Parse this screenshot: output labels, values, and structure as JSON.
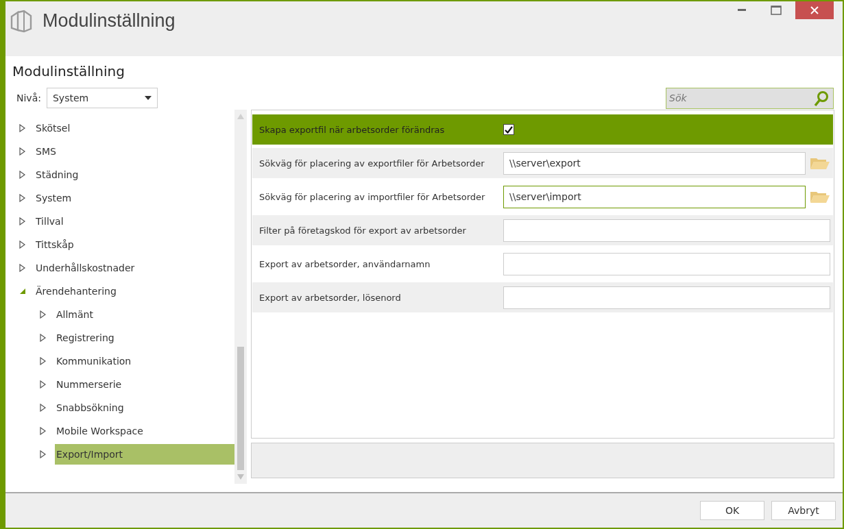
{
  "window": {
    "title": "Modulinställning"
  },
  "heading": "Modulinställning",
  "level_picker": {
    "label": "Nivå:",
    "value": "System"
  },
  "search": {
    "placeholder": "Sök"
  },
  "tree": [
    {
      "label": "Skötsel",
      "expanded": false,
      "selected": false
    },
    {
      "label": "SMS",
      "expanded": false,
      "selected": false
    },
    {
      "label": "Städning",
      "expanded": false,
      "selected": false
    },
    {
      "label": "System",
      "expanded": false,
      "selected": false
    },
    {
      "label": "Tillval",
      "expanded": false,
      "selected": false
    },
    {
      "label": "Tittskåp",
      "expanded": false,
      "selected": false
    },
    {
      "label": "Underhållskostnader",
      "expanded": false,
      "selected": false
    },
    {
      "label": "Ärendehantering",
      "expanded": true,
      "selected": false,
      "children": [
        {
          "label": "Allmänt",
          "expanded": false,
          "selected": false
        },
        {
          "label": "Registrering",
          "expanded": false,
          "selected": false
        },
        {
          "label": "Kommunikation",
          "expanded": false,
          "selected": false
        },
        {
          "label": "Nummerserie",
          "expanded": false,
          "selected": false
        },
        {
          "label": "Snabbsökning",
          "expanded": false,
          "selected": false
        },
        {
          "label": "Mobile Workspace",
          "expanded": false,
          "selected": false
        },
        {
          "label": "Export/Import",
          "expanded": false,
          "selected": true
        }
      ]
    }
  ],
  "settings": [
    {
      "kind": "checkbox",
      "label": "Skapa exportfil när arbetsorder förändras",
      "checked": true,
      "selected": true
    },
    {
      "kind": "path",
      "label": "Sökväg för placering av exportfiler för Arbetsorder",
      "value": "\\\\server\\export",
      "selected": false,
      "focused": false
    },
    {
      "kind": "path",
      "label": "Sökväg för placering av importfiler för Arbetsorder",
      "value": "\\\\server\\import",
      "selected": false,
      "focused": true
    },
    {
      "kind": "text",
      "label": "Filter på företagskod för export av arbetsorder",
      "selected": false,
      "focused": false
    },
    {
      "kind": "text",
      "label": "Export av arbetsorder, användarnamn",
      "selected": false,
      "focused": false
    },
    {
      "kind": "text",
      "label": "Export av arbetsorder, lösenord",
      "selected": false,
      "focused": false
    }
  ],
  "buttons": [
    "OK",
    "Avbryt"
  ]
}
